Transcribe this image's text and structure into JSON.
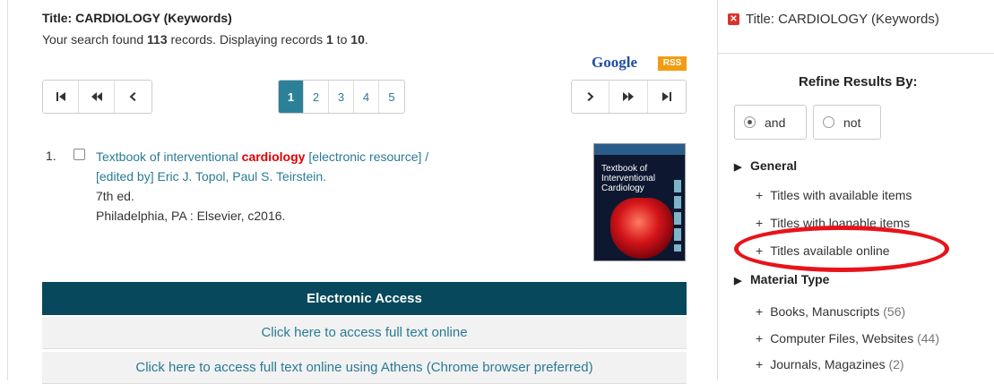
{
  "results": {
    "title_line": "Title: CARDIOLOGY (Keywords)",
    "summary_prefix": "Your search found ",
    "total_records": "113",
    "summary_middle": " records. Displaying records ",
    "range_start": "1",
    "summary_to": " to ",
    "range_end": "10",
    "summary_suffix": "."
  },
  "badges": {
    "google": "Google",
    "rss": "RSS"
  },
  "pager": {
    "pages": [
      "1",
      "2",
      "3",
      "4",
      "5"
    ],
    "active_page": "1"
  },
  "record": {
    "number": "1.",
    "title_part1": "Textbook of interventional ",
    "title_highlight": "cardiology",
    "title_part2": " [electronic resource] /",
    "authors": "[edited by] Eric J. Topol, Paul S. Teirstein.",
    "edition": "7th ed.",
    "imprint": "Philadelphia, PA : Elsevier, c2016.",
    "cover_text": "Textbook of Interventional Cardiology"
  },
  "electronic_access": {
    "header": "Electronic Access",
    "links": [
      "Click here to access full text online",
      "Click here to access full text online using Athens (Chrome browser preferred)"
    ]
  },
  "sidebar": {
    "active_filter": "Title: CARDIOLOGY (Keywords)",
    "refine_heading": "Refine Results By:",
    "bool_and": "and",
    "bool_not": "not",
    "general_heading": "General",
    "general_items": [
      "Titles with available items",
      "Titles with loanable items",
      "Titles available online"
    ],
    "material_heading": "Material Type",
    "material_items": [
      {
        "label": "Books, Manuscripts",
        "count": "(56)"
      },
      {
        "label": "Computer Files, Websites",
        "count": "(44)"
      },
      {
        "label": "Journals, Magazines",
        "count": "(2)"
      }
    ]
  },
  "colors": {
    "accent": "#2c8199",
    "header_bar": "#07485c",
    "highlight_red": "#e00000",
    "annotation_red": "#e8131a"
  }
}
